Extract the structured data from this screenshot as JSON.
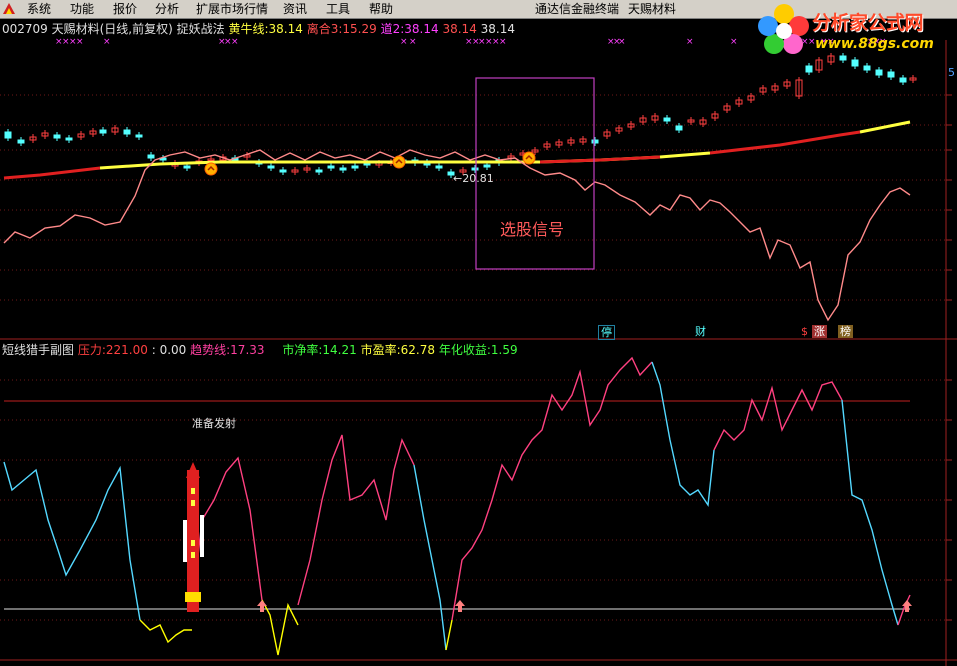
{
  "menubar": {
    "items": [
      "系统",
      "功能",
      "报价",
      "分析",
      "扩展市场行情",
      "资讯",
      "工具",
      "帮助"
    ],
    "right_items": [
      "通达信金融终端",
      "天赐材料"
    ]
  },
  "logo": {
    "title": "分析家公式网",
    "url_text": "www.88gs.com"
  },
  "main_info": {
    "code_name": "002709 天赐材料(日线,前复权)",
    "indicator": "捉妖战法",
    "f1_label": "黄牛线:",
    "f1_value": "38.14",
    "f2_label": "离合3:",
    "f2_value": "15.29",
    "f3_label": "道2:",
    "f3_value": "38.14",
    "f4_value": "38.14",
    "f5_value": "38.14"
  },
  "price_annotation": "←20.81",
  "signal_box_label": "选股信号",
  "right_axis_label": "5",
  "event_tags": [
    "停",
    "财",
    "$",
    "涨",
    "榜"
  ],
  "sub_info": {
    "title": "短线猎手副图",
    "pressure_label": "压力:",
    "pressure_value": "221.00",
    "zero_value": ": 0.00",
    "trend_label": "趋势线:",
    "trend_value": "17.33",
    "pb_label": "市净率:",
    "pb_value": "14.21",
    "pe_label": "市盈率:",
    "pe_value": "62.78",
    "yield_label": "年化收益:",
    "yield_value": "1.59"
  },
  "ready_label": "准备发射",
  "colors": {
    "background": "#000000",
    "price_up": "#ff4040",
    "price_down": "#54ffff",
    "ma_yellow": "#ffff40",
    "ma_red": "#e02020",
    "pink_line": "#ff8a8a",
    "signal_box": "#c040c0",
    "sub_pink": "#ff4080",
    "sub_cyan": "#54d8ff",
    "sub_yellow": "#ffff00"
  },
  "chart_data": [
    {
      "type": "line",
      "title": "捉妖战法",
      "series": [
        {
          "name": "黄牛线",
          "values": [
            38.14
          ]
        },
        {
          "name": "离合3",
          "values": [
            15.29
          ]
        },
        {
          "name": "道2",
          "values": [
            38.14
          ]
        }
      ]
    },
    {
      "type": "line",
      "title": "短线猎手副图",
      "series": [
        {
          "name": "压力",
          "values": [
            221.0
          ]
        },
        {
          "name": "趋势线",
          "values": [
            17.33
          ]
        }
      ]
    }
  ]
}
